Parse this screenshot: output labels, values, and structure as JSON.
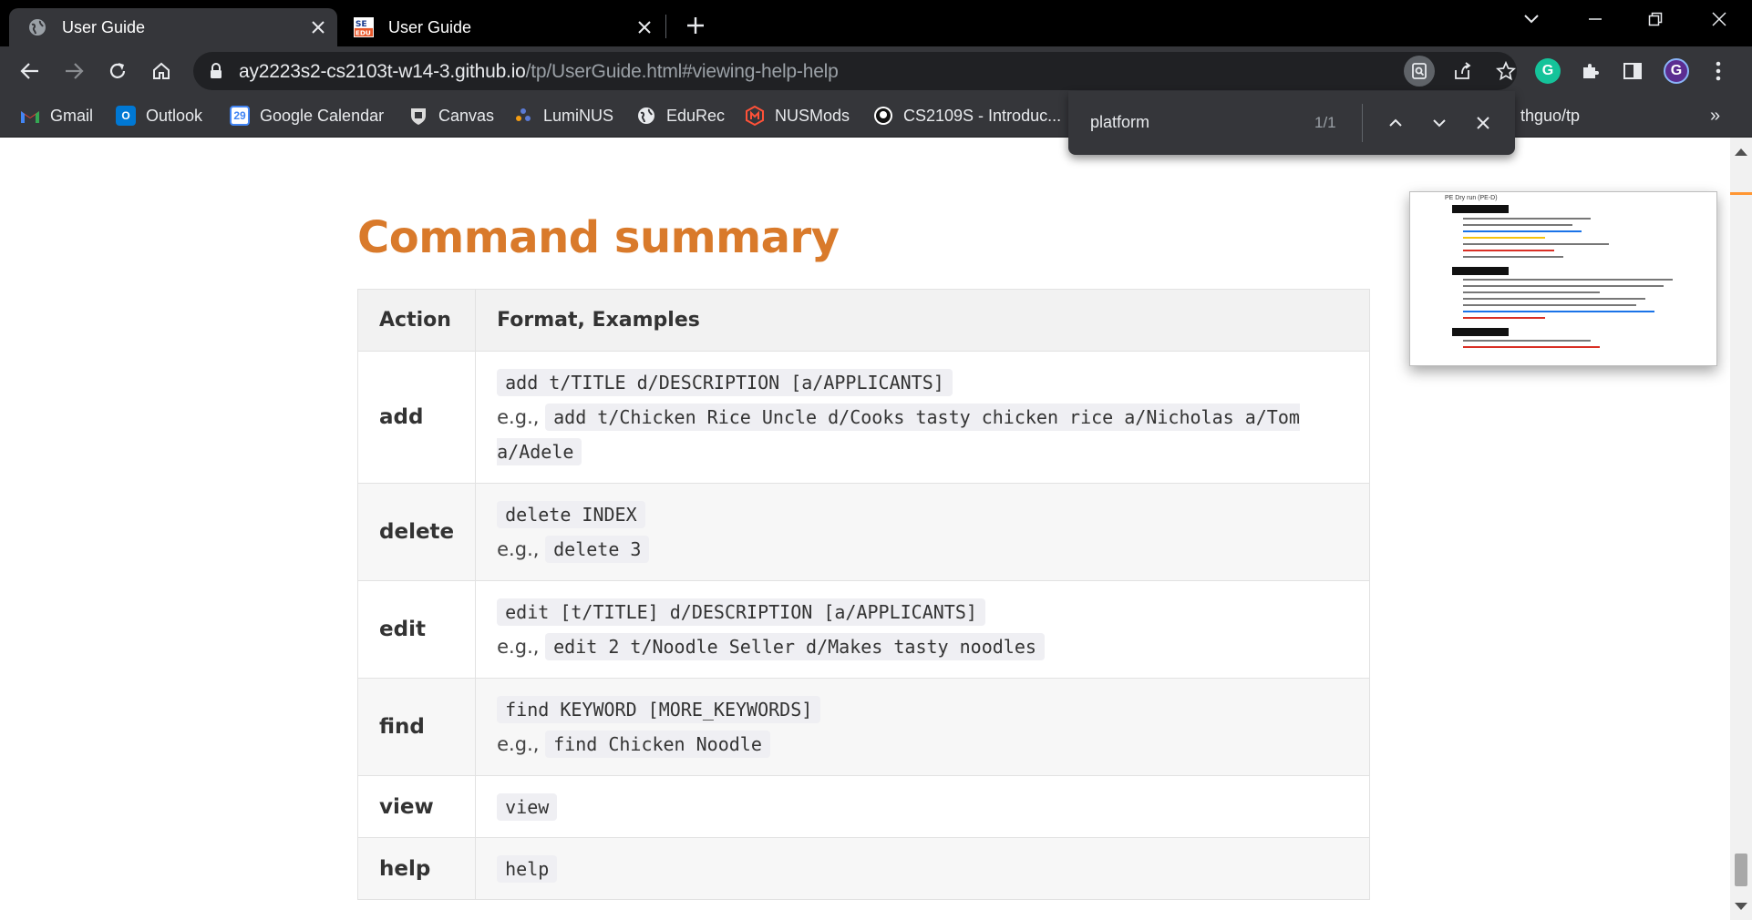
{
  "browser": {
    "tabs": [
      {
        "title": "User Guide",
        "icon": "globe-icon"
      },
      {
        "title": "User Guide",
        "icon": "se-edu-icon"
      }
    ],
    "url_host": "ay2223s2-cs2103t-w14-3.github.io",
    "url_path": "/tp/UserGuide.html#viewing-help-help",
    "profile_initial": "G",
    "extension_initial": "G",
    "bookmarks": [
      {
        "label": "Gmail",
        "icon": "gmail-icon",
        "color": "#ea4335"
      },
      {
        "label": "Outlook",
        "icon": "outlook-icon",
        "color": "#0078d4"
      },
      {
        "label": "Google Calendar",
        "icon": "calendar-icon",
        "color": "#4285f4"
      },
      {
        "label": "Canvas",
        "icon": "canvas-icon",
        "color": "#e3e3e3"
      },
      {
        "label": "LumiNUS",
        "icon": "luminus-icon",
        "color": "#5b7bd5"
      },
      {
        "label": "EduRec",
        "icon": "globe-icon",
        "color": "#e8eaed"
      },
      {
        "label": "NUSMods",
        "icon": "nusmods-icon",
        "color": "#ff5138"
      },
      {
        "label": "CS2109S - Introduc...",
        "icon": "github-icon",
        "color": "#ffffff"
      },
      {
        "label": "thguo/tp",
        "icon": "github-icon",
        "color": "#ffffff"
      }
    ],
    "calendar_day": "29"
  },
  "find": {
    "query": "platform",
    "count": "1/1"
  },
  "page": {
    "title": "Command summary",
    "table": {
      "headers": [
        "Action",
        "Format, Examples"
      ],
      "rows": [
        {
          "action": "add",
          "format": "add t/TITLE d/DESCRIPTION [a/APPLICANTS]",
          "eg_prefix": "e.g.,",
          "example": "add t/Chicken Rice Uncle d/Cooks tasty chicken rice a/Nicholas a/Tom a/Adele"
        },
        {
          "action": "delete",
          "format": "delete INDEX",
          "eg_prefix": "e.g.,",
          "example": "delete 3"
        },
        {
          "action": "edit",
          "format": "edit [t/TITLE] d/DESCRIPTION [a/APPLICANTS]",
          "eg_prefix": "e.g.,",
          "example": "edit 2 t/Noodle Seller d/Makes tasty noodles"
        },
        {
          "action": "find",
          "format": "find KEYWORD [MORE_KEYWORDS]",
          "eg_prefix": "e.g.,",
          "example": "find Chicken Noodle"
        },
        {
          "action": "view",
          "format": "view"
        },
        {
          "action": "help",
          "format": "help"
        }
      ]
    }
  },
  "thumbnail": {
    "title": "PE Dry run (PE-D)"
  },
  "colors": {
    "heading": "#d97a2b",
    "find_marker": "#ff9632"
  }
}
